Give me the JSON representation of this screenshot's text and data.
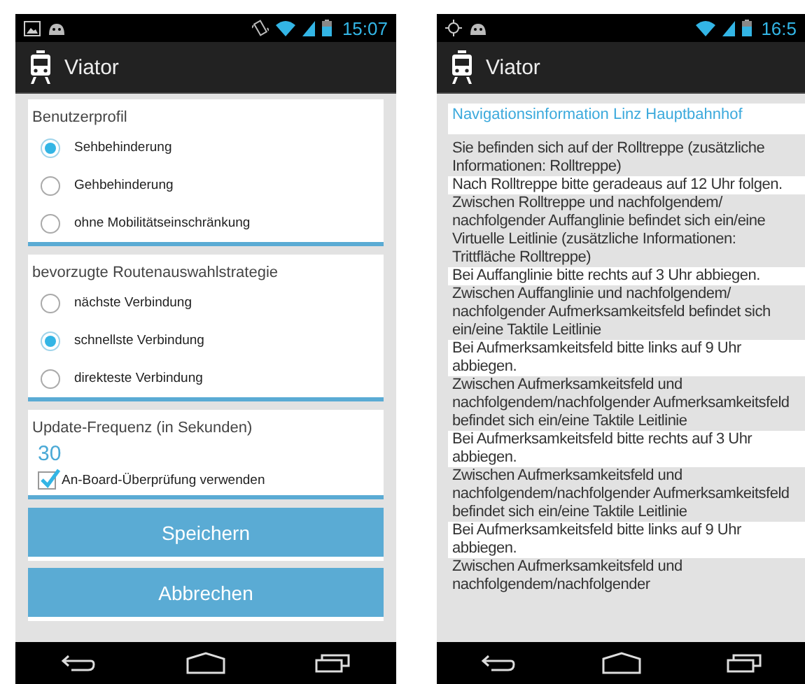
{
  "screens": [
    {
      "kind": "settings",
      "status_bar": {
        "time": "15:07"
      },
      "app_title": "Viator",
      "groups": [
        {
          "title": "Benutzerprofil",
          "options": [
            {
              "label": "Sehbehinderung",
              "selected": true
            },
            {
              "label": "Gehbehinderung",
              "selected": false
            },
            {
              "label": "ohne Mobilitätseinschränkung",
              "selected": false
            }
          ]
        },
        {
          "title": "bevorzugte Routenauswahlstrategie",
          "options": [
            {
              "label": "nächste Verbindung",
              "selected": false
            },
            {
              "label": "schnellste Verbindung",
              "selected": true
            },
            {
              "label": "direkteste Verbindung",
              "selected": false
            }
          ]
        }
      ],
      "update": {
        "label": "Update-Frequenz (in Sekunden)",
        "value": "30",
        "checkbox": {
          "label": "An-Board-Überprüfung verwenden",
          "checked": true
        }
      },
      "buttons": [
        "Speichern",
        "Abbrechen"
      ]
    },
    {
      "kind": "navigation",
      "status_bar": {
        "time": "16:5"
      },
      "app_title": "Viator",
      "heading": "Navigationsinformation Linz Hauptbahnhof",
      "steps": [
        "Sie befinden sich auf der Rolltreppe (zusätzliche Informationen: Rolltreppe)",
        "Nach Rolltreppe bitte geradeaus auf 12 Uhr folgen.",
        "Zwischen Rolltreppe und nachfolgendem/ nachfolgender Auffanglinie befindet sich ein/eine Virtuelle Leitlinie (zusätzliche Informationen: Trittfläche Rolltreppe)",
        "Bei Auffanglinie bitte rechts auf 3 Uhr abbiegen.",
        "Zwischen Auffanglinie und nachfolgendem/ nachfolgender Aufmerksamkeitsfeld befindet sich ein/eine Taktile Leitlinie",
        "Bei Aufmerksamkeitsfeld bitte links auf 9 Uhr abbiegen.",
        "Zwischen Aufmerksamkeitsfeld und nachfolgendem/nachfolgender Aufmerksamkeitsfeld befindet sich ein/eine Taktile Leitlinie",
        "Bei Aufmerksamkeitsfeld bitte rechts auf 3 Uhr abbiegen.",
        "Zwischen Aufmerksamkeitsfeld und nachfolgendem/nachfolgender Aufmerksamkeitsfeld befindet sich ein/eine Taktile Leitlinie",
        "Bei Aufmerksamkeitsfeld bitte links auf 9 Uhr abbiegen.",
        "Zwischen Aufmerksamkeitsfeld und nachfolgendem/nachfolgender"
      ]
    }
  ]
}
